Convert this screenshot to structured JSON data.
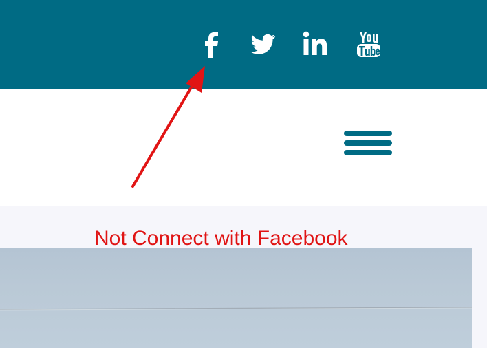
{
  "top_bar": {
    "background_color": "#006b84",
    "social_icons": [
      {
        "name": "facebook-icon",
        "color": "#ffffff"
      },
      {
        "name": "twitter-icon",
        "color": "#ffffff"
      },
      {
        "name": "linkedin-icon",
        "color": "#ffffff"
      },
      {
        "name": "youtube-icon",
        "color": "#ffffff"
      }
    ]
  },
  "header": {
    "menu_icon": "hamburger-menu-icon",
    "menu_color": "#006b84"
  },
  "annotation": {
    "text": "Not Connect with Facebook",
    "color": "#e01414",
    "arrow_icon": "red-arrow-annotation"
  },
  "content": {
    "background_color": "#f6f6fb",
    "hero_image": "sea-horizon-image"
  }
}
